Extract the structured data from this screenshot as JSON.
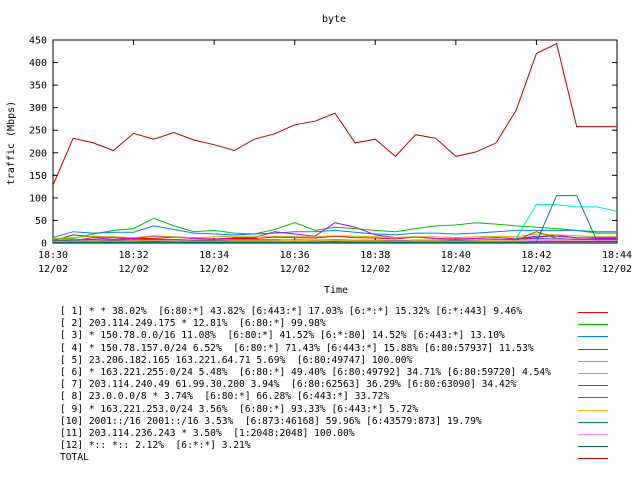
{
  "chart_data": {
    "type": "line",
    "title": "byte",
    "xlabel": "Time",
    "ylabel": "traffic (Mbps)",
    "ylim": [
      0,
      450
    ],
    "yticks": [
      "0",
      "50",
      "100",
      "150",
      "200",
      "250",
      "300",
      "350",
      "400",
      "450"
    ],
    "xticks": [
      {
        "minute": 0,
        "time": "18:30",
        "date": "12/02"
      },
      {
        "minute": 2,
        "time": "18:32",
        "date": "12/02"
      },
      {
        "minute": 4,
        "time": "18:34",
        "date": "12/02"
      },
      {
        "minute": 6,
        "time": "18:36",
        "date": "12/02"
      },
      {
        "minute": 8,
        "time": "18:38",
        "date": "12/02"
      },
      {
        "minute": 10,
        "time": "18:40",
        "date": "12/02"
      },
      {
        "minute": 12,
        "time": "18:42",
        "date": "12/02"
      },
      {
        "minute": 14,
        "time": "18:44",
        "date": "12/02"
      }
    ],
    "xlim": [
      0,
      14
    ],
    "x": [
      0,
      0.5,
      1,
      1.5,
      2,
      2.5,
      3,
      3.5,
      4,
      4.5,
      5,
      5.5,
      6,
      6.5,
      7,
      7.5,
      8,
      8.5,
      9,
      9.5,
      10,
      10.5,
      11,
      11.5,
      12,
      12.5,
      13,
      13.5,
      14
    ],
    "grid": false,
    "legend_position": "bottom",
    "series": [
      {
        "name": "[ 1] * * 38.02%  [6:80:*] 43.82% [6:443:*] 17.03% [6:*:*] 15.32% [6:*:443] 9.46%",
        "color": "#ff0000",
        "values": [
          5,
          18,
          14,
          12,
          10,
          10,
          13,
          10,
          9,
          10,
          10,
          13,
          12,
          11,
          15,
          12,
          11,
          9,
          13,
          10,
          9,
          10,
          12,
          9,
          12,
          18,
          11,
          12,
          12
        ]
      },
      {
        "name": "[ 2] 203.114.249.175 * 12.81%  [6:80:*] 99.98%",
        "color": "#00c000",
        "values": [
          8,
          10,
          20,
          28,
          32,
          55,
          38,
          25,
          28,
          22,
          20,
          30,
          45,
          28,
          35,
          32,
          28,
          25,
          32,
          38,
          40,
          45,
          42,
          38,
          35,
          32,
          28,
          22,
          22
        ]
      },
      {
        "name": "[ 3] * 150.78.0.0/16 11.08%  [6:80:*] 41.52% [6:*:80] 14.52% [6:443:*] 13.10%",
        "color": "#0080ff",
        "values": [
          12,
          25,
          22,
          24,
          24,
          38,
          30,
          22,
          20,
          18,
          20,
          22,
          25,
          25,
          28,
          24,
          20,
          18,
          22,
          22,
          20,
          22,
          25,
          28,
          28,
          28,
          28,
          25,
          25
        ]
      },
      {
        "name": "[ 4] * 150.78.157.0/24 6.52%  [6:80:*] 71.43% [6:443:*] 15.88% [6:80:57937] 11.53%",
        "color": "#c000ff",
        "values": [
          2,
          5,
          12,
          8,
          10,
          15,
          14,
          10,
          8,
          12,
          12,
          25,
          20,
          15,
          45,
          35,
          18,
          12,
          14,
          10,
          8,
          10,
          12,
          10,
          15,
          15,
          12,
          10,
          10
        ]
      },
      {
        "name": "[ 5] 23.206.182.165 163.221.64.71 5.69%  [6:80:49747] 100.00%",
        "color": "#00e0e0",
        "values": [
          1,
          1,
          1,
          1,
          1,
          1,
          1,
          1,
          1,
          1,
          1,
          1,
          1,
          1,
          1,
          1,
          1,
          1,
          1,
          1,
          1,
          1,
          1,
          10,
          86,
          85,
          80,
          80,
          70
        ]
      },
      {
        "name": "[ 6] * 163.221.255.0/24 5.48%  [6:80:*] 49.40% [6:80:49792] 34.71% [6:80:59720] 4.54%",
        "color": "#b8b800",
        "values": [
          10,
          12,
          15,
          14,
          12,
          16,
          14,
          12,
          14,
          15,
          15,
          15,
          14,
          14,
          16,
          15,
          14,
          12,
          14,
          14,
          12,
          14,
          15,
          14,
          20,
          18,
          16,
          14,
          14
        ]
      },
      {
        "name": "[ 7] 203.114.240.49 61.99.30.200 3.94%  [6:80:62563] 36.29% [6:80:63090] 34.42%",
        "color": "#806000",
        "values": [
          5,
          7,
          8,
          6,
          7,
          8,
          8,
          6,
          6,
          7,
          7,
          7,
          6,
          6,
          7,
          6,
          6,
          5,
          6,
          6,
          5,
          6,
          8,
          6,
          25,
          10,
          8,
          7,
          7
        ]
      },
      {
        "name": "[ 8] 23.0.0.0/8 * 3.74%  [6:80:*] 66.28% [6:443:*] 33.72%",
        "color": "#4060c0",
        "values": [
          4,
          5,
          6,
          5,
          6,
          7,
          6,
          5,
          5,
          6,
          6,
          6,
          7,
          6,
          6,
          5,
          5,
          5,
          6,
          6,
          6,
          6,
          7,
          8,
          10,
          9,
          8,
          8,
          8
        ]
      },
      {
        "name": "[ 9] * 163.221.253.0/24 3.56%  [6:80:*] 93.33% [6:443:*] 5.72%",
        "color": "#ffb000",
        "values": [
          3,
          4,
          5,
          4,
          5,
          5,
          5,
          4,
          4,
          5,
          5,
          5,
          6,
          5,
          6,
          5,
          5,
          4,
          5,
          5,
          4,
          5,
          6,
          5,
          8,
          6,
          5,
          5,
          5
        ]
      },
      {
        "name": "[10] 2001::/16 2001::/16 3.53%  [6:873:46168] 59.96% [6:43579:873] 19.79%",
        "color": "#008080",
        "values": [
          1,
          1,
          1,
          1,
          1,
          1,
          1,
          1,
          1,
          1,
          1,
          1,
          1,
          1,
          1,
          1,
          1,
          1,
          1,
          1,
          1,
          1,
          1,
          1,
          1,
          105,
          105,
          5,
          5
        ]
      },
      {
        "name": "[11] 203.114.236.243 * 3.50%  [1:2048:2048] 100.00%",
        "color": "#ff80ff",
        "values": [
          2,
          3,
          3,
          3,
          3,
          4,
          4,
          3,
          3,
          3,
          3,
          3,
          3,
          3,
          3,
          3,
          3,
          3,
          3,
          3,
          3,
          3,
          4,
          4,
          6,
          5,
          5,
          5,
          5
        ]
      },
      {
        "name": "[12] *:: *:: 2.12%  [6:*:*] 3.21%",
        "color": "#006060",
        "values": [
          1,
          2,
          2,
          2,
          2,
          3,
          2,
          2,
          2,
          2,
          2,
          2,
          2,
          2,
          3,
          2,
          2,
          2,
          2,
          2,
          2,
          2,
          2,
          2,
          3,
          3,
          3,
          3,
          3
        ]
      },
      {
        "name": "TOTAL",
        "color": "#b00000",
        "values": [
          128,
          232,
          222,
          205,
          243,
          230,
          245,
          228,
          218,
          205,
          230,
          242,
          262,
          270,
          288,
          222,
          230,
          192,
          240,
          232,
          192,
          202,
          222,
          295,
          420,
          442,
          258,
          258,
          258
        ]
      }
    ]
  }
}
